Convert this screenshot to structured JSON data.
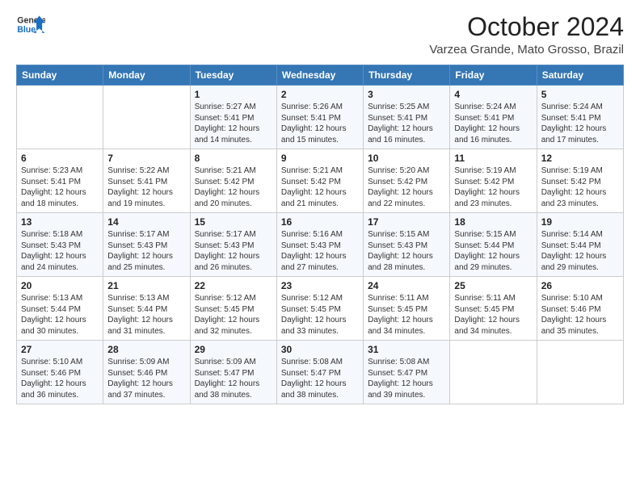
{
  "header": {
    "logo_line1": "General",
    "logo_line2": "Blue",
    "month": "October 2024",
    "location": "Varzea Grande, Mato Grosso, Brazil"
  },
  "days_of_week": [
    "Sunday",
    "Monday",
    "Tuesday",
    "Wednesday",
    "Thursday",
    "Friday",
    "Saturday"
  ],
  "weeks": [
    [
      {
        "day": "",
        "info": ""
      },
      {
        "day": "",
        "info": ""
      },
      {
        "day": "1",
        "info": "Sunrise: 5:27 AM\nSunset: 5:41 PM\nDaylight: 12 hours and 14 minutes."
      },
      {
        "day": "2",
        "info": "Sunrise: 5:26 AM\nSunset: 5:41 PM\nDaylight: 12 hours and 15 minutes."
      },
      {
        "day": "3",
        "info": "Sunrise: 5:25 AM\nSunset: 5:41 PM\nDaylight: 12 hours and 16 minutes."
      },
      {
        "day": "4",
        "info": "Sunrise: 5:24 AM\nSunset: 5:41 PM\nDaylight: 12 hours and 16 minutes."
      },
      {
        "day": "5",
        "info": "Sunrise: 5:24 AM\nSunset: 5:41 PM\nDaylight: 12 hours and 17 minutes."
      }
    ],
    [
      {
        "day": "6",
        "info": "Sunrise: 5:23 AM\nSunset: 5:41 PM\nDaylight: 12 hours and 18 minutes."
      },
      {
        "day": "7",
        "info": "Sunrise: 5:22 AM\nSunset: 5:41 PM\nDaylight: 12 hours and 19 minutes."
      },
      {
        "day": "8",
        "info": "Sunrise: 5:21 AM\nSunset: 5:42 PM\nDaylight: 12 hours and 20 minutes."
      },
      {
        "day": "9",
        "info": "Sunrise: 5:21 AM\nSunset: 5:42 PM\nDaylight: 12 hours and 21 minutes."
      },
      {
        "day": "10",
        "info": "Sunrise: 5:20 AM\nSunset: 5:42 PM\nDaylight: 12 hours and 22 minutes."
      },
      {
        "day": "11",
        "info": "Sunrise: 5:19 AM\nSunset: 5:42 PM\nDaylight: 12 hours and 23 minutes."
      },
      {
        "day": "12",
        "info": "Sunrise: 5:19 AM\nSunset: 5:42 PM\nDaylight: 12 hours and 23 minutes."
      }
    ],
    [
      {
        "day": "13",
        "info": "Sunrise: 5:18 AM\nSunset: 5:43 PM\nDaylight: 12 hours and 24 minutes."
      },
      {
        "day": "14",
        "info": "Sunrise: 5:17 AM\nSunset: 5:43 PM\nDaylight: 12 hours and 25 minutes."
      },
      {
        "day": "15",
        "info": "Sunrise: 5:17 AM\nSunset: 5:43 PM\nDaylight: 12 hours and 26 minutes."
      },
      {
        "day": "16",
        "info": "Sunrise: 5:16 AM\nSunset: 5:43 PM\nDaylight: 12 hours and 27 minutes."
      },
      {
        "day": "17",
        "info": "Sunrise: 5:15 AM\nSunset: 5:43 PM\nDaylight: 12 hours and 28 minutes."
      },
      {
        "day": "18",
        "info": "Sunrise: 5:15 AM\nSunset: 5:44 PM\nDaylight: 12 hours and 29 minutes."
      },
      {
        "day": "19",
        "info": "Sunrise: 5:14 AM\nSunset: 5:44 PM\nDaylight: 12 hours and 29 minutes."
      }
    ],
    [
      {
        "day": "20",
        "info": "Sunrise: 5:13 AM\nSunset: 5:44 PM\nDaylight: 12 hours and 30 minutes."
      },
      {
        "day": "21",
        "info": "Sunrise: 5:13 AM\nSunset: 5:44 PM\nDaylight: 12 hours and 31 minutes."
      },
      {
        "day": "22",
        "info": "Sunrise: 5:12 AM\nSunset: 5:45 PM\nDaylight: 12 hours and 32 minutes."
      },
      {
        "day": "23",
        "info": "Sunrise: 5:12 AM\nSunset: 5:45 PM\nDaylight: 12 hours and 33 minutes."
      },
      {
        "day": "24",
        "info": "Sunrise: 5:11 AM\nSunset: 5:45 PM\nDaylight: 12 hours and 34 minutes."
      },
      {
        "day": "25",
        "info": "Sunrise: 5:11 AM\nSunset: 5:45 PM\nDaylight: 12 hours and 34 minutes."
      },
      {
        "day": "26",
        "info": "Sunrise: 5:10 AM\nSunset: 5:46 PM\nDaylight: 12 hours and 35 minutes."
      }
    ],
    [
      {
        "day": "27",
        "info": "Sunrise: 5:10 AM\nSunset: 5:46 PM\nDaylight: 12 hours and 36 minutes."
      },
      {
        "day": "28",
        "info": "Sunrise: 5:09 AM\nSunset: 5:46 PM\nDaylight: 12 hours and 37 minutes."
      },
      {
        "day": "29",
        "info": "Sunrise: 5:09 AM\nSunset: 5:47 PM\nDaylight: 12 hours and 38 minutes."
      },
      {
        "day": "30",
        "info": "Sunrise: 5:08 AM\nSunset: 5:47 PM\nDaylight: 12 hours and 38 minutes."
      },
      {
        "day": "31",
        "info": "Sunrise: 5:08 AM\nSunset: 5:47 PM\nDaylight: 12 hours and 39 minutes."
      },
      {
        "day": "",
        "info": ""
      },
      {
        "day": "",
        "info": ""
      }
    ]
  ]
}
